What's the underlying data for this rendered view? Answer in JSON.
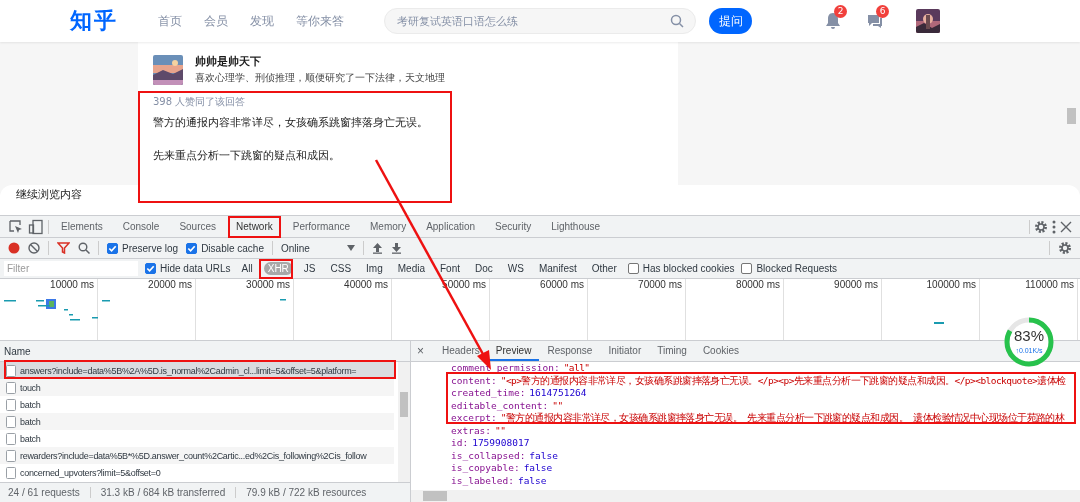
{
  "topbar": {
    "logo": "知乎",
    "nav": [
      "首页",
      "会员",
      "发现",
      "等你来答"
    ],
    "search": {
      "placeholder": "考研复试英语口语怎么练"
    },
    "ask_button": "提问",
    "notifications": {
      "badge": "2"
    },
    "messages": {
      "badge": "6"
    }
  },
  "answer": {
    "author": "帅帅是帅天下",
    "bio": "喜欢心理学、刑侦推理，顺便研究了一下法律，天文地理",
    "upvotes": "398 人赞同了该回答",
    "paragraphs": [
      "警方的通报内容非常详尽，女孩确系跳窗摔落身亡无误。",
      "先来重点分析一下跳窗的疑点和成因。"
    ]
  },
  "continue_bar": "继续浏览内容",
  "devtools": {
    "tabs": [
      {
        "label": "Elements",
        "selected": false
      },
      {
        "label": "Console",
        "selected": false
      },
      {
        "label": "Sources",
        "selected": false
      },
      {
        "label": "Network",
        "selected": true
      },
      {
        "label": "Performance",
        "selected": false
      },
      {
        "label": "Memory",
        "selected": false
      },
      {
        "label": "Application",
        "selected": false
      },
      {
        "label": "Security",
        "selected": false
      },
      {
        "label": "Lighthouse",
        "selected": false
      }
    ],
    "toolbar": {
      "preserve_log": {
        "label": "Preserve log",
        "checked": true
      },
      "disable_cache": {
        "label": "Disable cache",
        "checked": true
      },
      "throttling": "Online"
    },
    "filter": {
      "placeholder": "Filter",
      "hide_data_urls": {
        "label": "Hide data URLs",
        "checked": true
      },
      "types": [
        {
          "label": "All",
          "selected": false
        },
        {
          "label": "XHR",
          "selected": true
        },
        {
          "label": "JS",
          "selected": false
        },
        {
          "label": "CSS",
          "selected": false
        },
        {
          "label": "Img",
          "selected": false
        },
        {
          "label": "Media",
          "selected": false
        },
        {
          "label": "Font",
          "selected": false
        },
        {
          "label": "Doc",
          "selected": false
        },
        {
          "label": "WS",
          "selected": false
        },
        {
          "label": "Manifest",
          "selected": false
        },
        {
          "label": "Other",
          "selected": false
        }
      ],
      "has_blocked_cookies": {
        "label": "Has blocked cookies",
        "checked": false
      },
      "blocked_requests": {
        "label": "Blocked Requests",
        "checked": false
      }
    },
    "timeline": {
      "ticks": [
        "10000 ms",
        "20000 ms",
        "30000 ms",
        "40000 ms",
        "50000 ms",
        "60000 ms",
        "70000 ms",
        "80000 ms",
        "90000 ms",
        "100000 ms",
        "110000 ms"
      ]
    },
    "requests": {
      "header": "Name",
      "rows": [
        {
          "name": "answers?include=data%5B%2A%5D.is_normal%2Cadmin_cl...limit=5&offset=5&platform=",
          "selected": true
        },
        {
          "name": "touch",
          "selected": false
        },
        {
          "name": "batch",
          "selected": false
        },
        {
          "name": "batch",
          "selected": false
        },
        {
          "name": "batch",
          "selected": false
        },
        {
          "name": "rewarders?include=data%5B*%5D.answer_count%2Cartic...ed%2Cis_following%2Cis_follow",
          "selected": false
        },
        {
          "name": "concerned_upvoters?limit=5&offset=0",
          "selected": false
        }
      ]
    },
    "detail": {
      "close": "×",
      "tabs": [
        {
          "label": "Headers",
          "selected": false
        },
        {
          "label": "Preview",
          "selected": true
        },
        {
          "label": "Response",
          "selected": false
        },
        {
          "label": "Initiator",
          "selected": false
        },
        {
          "label": "Timing",
          "selected": false
        },
        {
          "label": "Cookies",
          "selected": false
        }
      ],
      "lines": [
        {
          "key": "comment_permission:",
          "value": "\"all\"",
          "kind": "string"
        },
        {
          "key": "content:",
          "value": "\"<p>警方的通报内容非常详尽，女孩确系跳窗摔落身亡无误。</p><p>先来重点分析一下跳窗的疑点和成因。</p><blockquote>遗体检",
          "kind": "string"
        },
        {
          "key": "created_time:",
          "value": "1614751264",
          "kind": "number"
        },
        {
          "key": "editable_content:",
          "value": "\"\"",
          "kind": "string"
        },
        {
          "key": "excerpt:",
          "value": "\"警方的通报内容非常详尽，女孩确系跳窗摔落身亡无误。 先来重点分析一下跳窗的疑点和成因。 遗体检验情况中心现场位于苑路的林",
          "kind": "string"
        },
        {
          "key": "extras:",
          "value": "\"\"",
          "kind": "string"
        },
        {
          "key": "id:",
          "value": "1759908017",
          "kind": "number"
        },
        {
          "key": "is_collapsed:",
          "value": "false",
          "kind": "boolean"
        },
        {
          "key": "is_copyable:",
          "value": "false",
          "kind": "boolean"
        },
        {
          "key": "is_labeled:",
          "value": "false",
          "kind": "boolean"
        }
      ]
    },
    "status_bar": [
      "24 / 61 requests",
      "31.3 kB / 684 kB transferred",
      "79.9 kB / 722 kB resources"
    ]
  },
  "speed_widget": {
    "percent": "83%",
    "rate": "↑0.01K/s"
  }
}
